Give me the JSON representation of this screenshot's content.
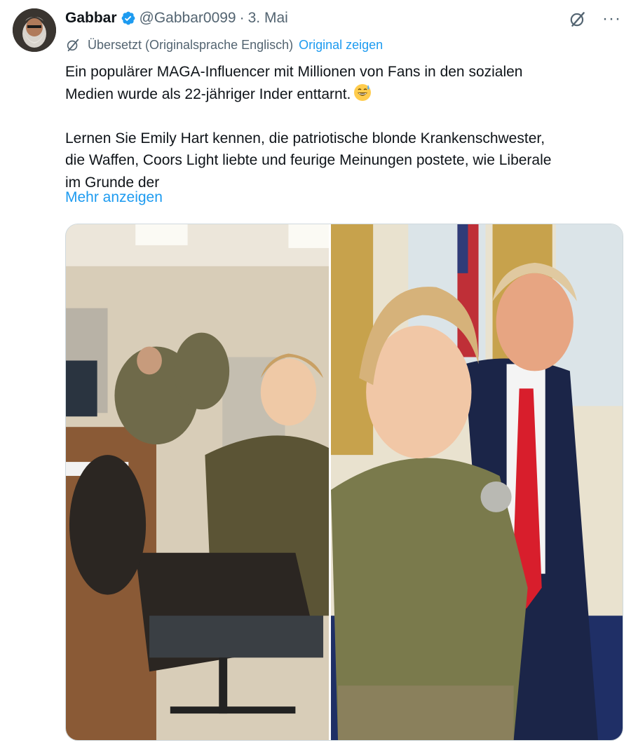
{
  "author": {
    "display_name": "Gabbar",
    "handle": "@Gabbar0099",
    "separator": "·",
    "date": "3. Mai",
    "verified_color": "#1d9bf0"
  },
  "translation": {
    "label": "Übersetzt (Originalsprache Englisch)",
    "link": "Original zeigen"
  },
  "tweet": {
    "lines": [
      "Ein populärer MAGA-Influencer mit Millionen von Fans in den sozialen",
      "Medien wurde als 22-jähriger Inder enttarnt.",
      "Lernen Sie Emily Hart kennen, die patriotische blonde Krankenschwester,",
      "die Waffen, Coors Light liebte und feurige Meinungen postete, wie Liberale",
      "im Grunde der"
    ],
    "show_more": "Mehr anzeigen"
  },
  "icons": {
    "verified": "verified-badge-icon",
    "grok": "grok-icon",
    "more": "more-icon",
    "translate": "translate-icon",
    "emoji": "grinning-sweat-emoji"
  },
  "media": {
    "count": 2
  },
  "colors": {
    "accent": "#1d9bf0",
    "secondary_text": "#536471",
    "primary_text": "#0f1419"
  }
}
